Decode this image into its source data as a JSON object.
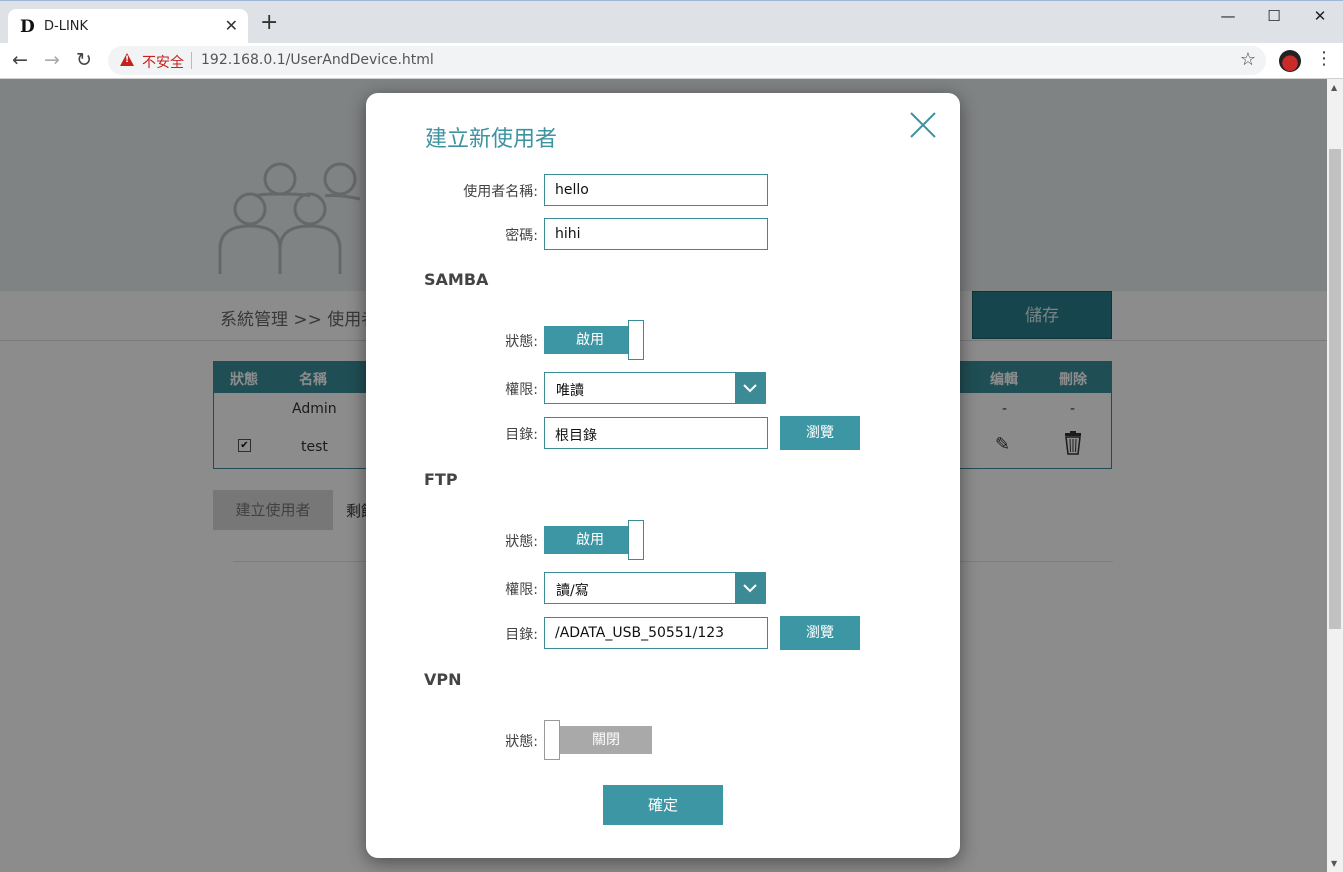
{
  "browser": {
    "tab_title": "D-LINK",
    "tab_logo": "D",
    "insecure_label": "不安全",
    "url": "192.168.0.1/UserAndDevice.html"
  },
  "page": {
    "breadcrumb": "系統管理 >> 使用者",
    "save_label": "儲存",
    "table": {
      "headers": [
        "狀態",
        "名稱",
        "编輯",
        "刪除"
      ],
      "rows": [
        {
          "name": "Admin",
          "edit": "-",
          "delete": "-"
        },
        {
          "name": "test",
          "checked": true
        }
      ]
    },
    "create_user_label": "建立使用者",
    "remaining_label": "剩餘"
  },
  "modal": {
    "title": "建立新使用者",
    "username_label": "使用者名稱:",
    "username_value": "hello",
    "password_label": "密碼:",
    "password_value": "hihi",
    "samba": {
      "heading": "SAMBA",
      "status_label": "狀態:",
      "status_value": "啟用",
      "permission_label": "權限:",
      "permission_value": "唯讀",
      "directory_label": "目錄:",
      "directory_value": "根目錄",
      "browse_label": "瀏覽"
    },
    "ftp": {
      "heading": "FTP",
      "status_label": "狀態:",
      "status_value": "啟用",
      "permission_label": "權限:",
      "permission_value": "讀/寫",
      "directory_label": "目錄:",
      "directory_value": "/ADATA_USB_50551/123",
      "browse_label": "瀏覽"
    },
    "vpn": {
      "heading": "VPN",
      "status_label": "狀態:",
      "status_value": "關閉"
    },
    "confirm_label": "確定"
  },
  "colors": {
    "accent": "#3d96a3",
    "header_teal": "#3b8f9c",
    "insecure_red": "#c5221f"
  }
}
